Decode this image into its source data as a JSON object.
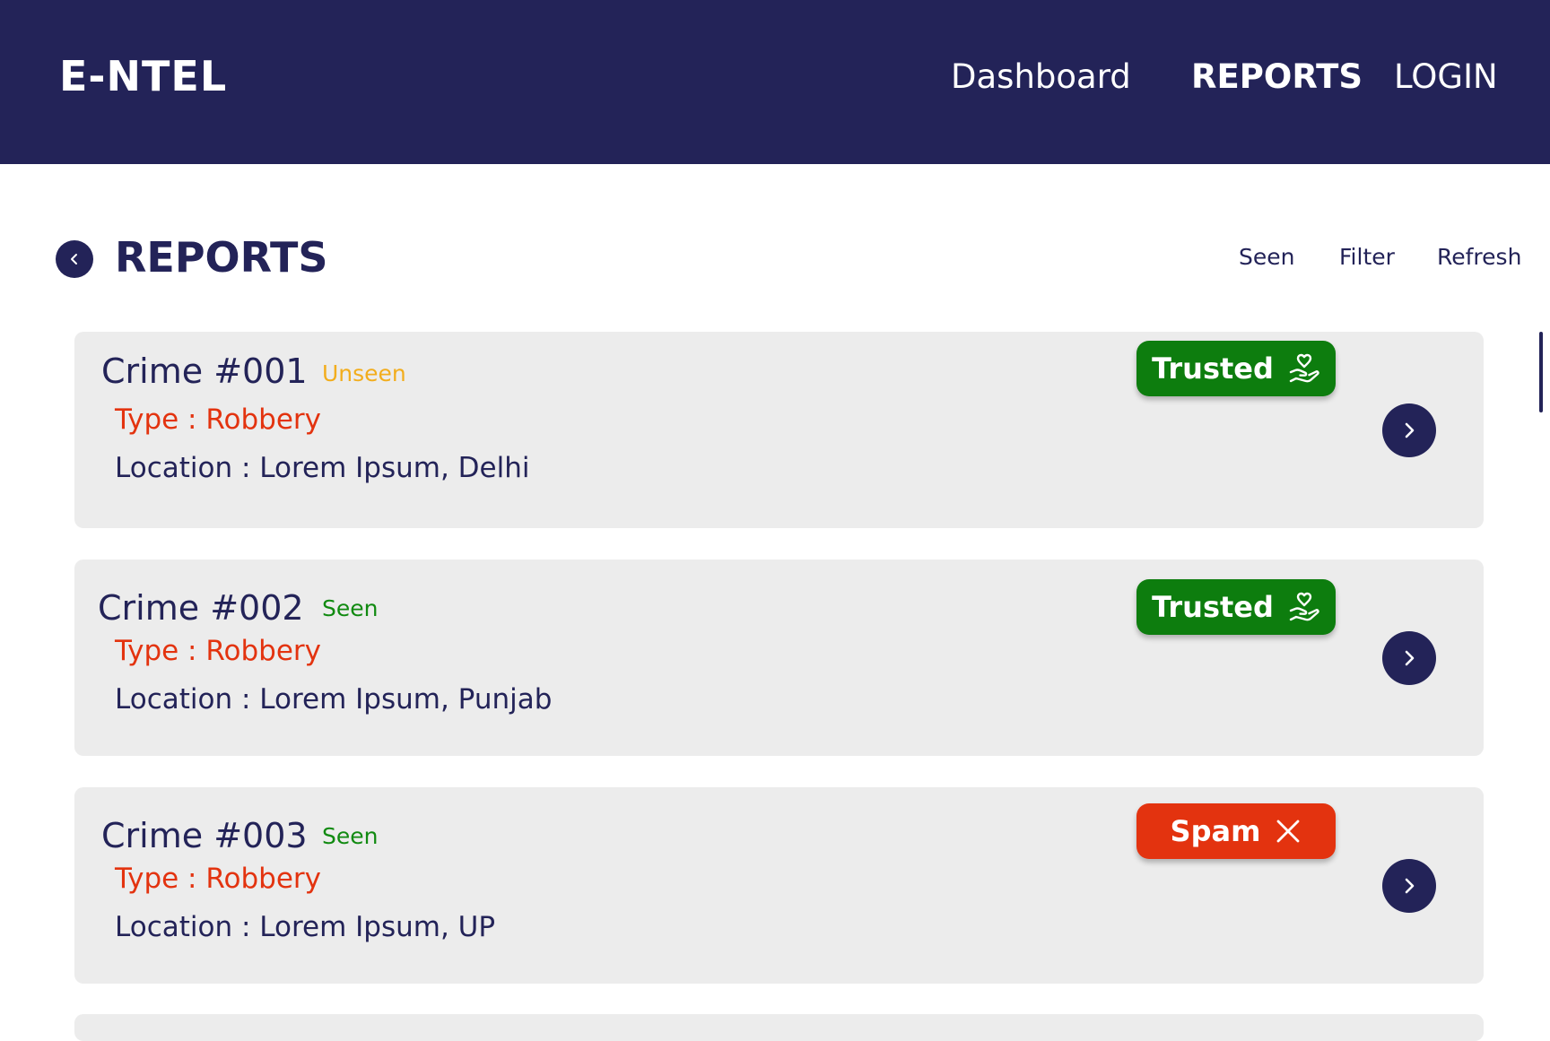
{
  "app": {
    "logo": "E-NTEL"
  },
  "nav": {
    "items": [
      {
        "label": "Dashboard",
        "active": false
      },
      {
        "label": "REPORTS",
        "active": true
      },
      {
        "label": "LOGIN",
        "active": false
      }
    ]
  },
  "page": {
    "title": "REPORTS",
    "actions": [
      "Seen",
      "Filter",
      "Refresh"
    ]
  },
  "colors": {
    "navy": "#232358",
    "trusted": "#0d7d0e",
    "spam": "#e3330f",
    "unseen": "#f2ad1d",
    "seen": "#118a11",
    "card_bg": "#ececec"
  },
  "reports": [
    {
      "title": "Crime #001",
      "status": "Unseen",
      "type": "Type : Robbery",
      "location": "Location : Lorem Ipsum, Delhi",
      "badge": {
        "label": "Trusted",
        "icon": "hand-heart-icon"
      }
    },
    {
      "title": "Crime #002",
      "status": "Seen",
      "type": "Type : Robbery",
      "location": "Location : Lorem Ipsum, Punjab",
      "badge": {
        "label": "Trusted",
        "icon": "hand-heart-icon"
      }
    },
    {
      "title": "Crime #003",
      "status": "Seen",
      "type": "Type : Robbery",
      "location": "Location : Lorem Ipsum, UP",
      "badge": {
        "label": "Spam",
        "icon": "close-icon"
      }
    }
  ]
}
